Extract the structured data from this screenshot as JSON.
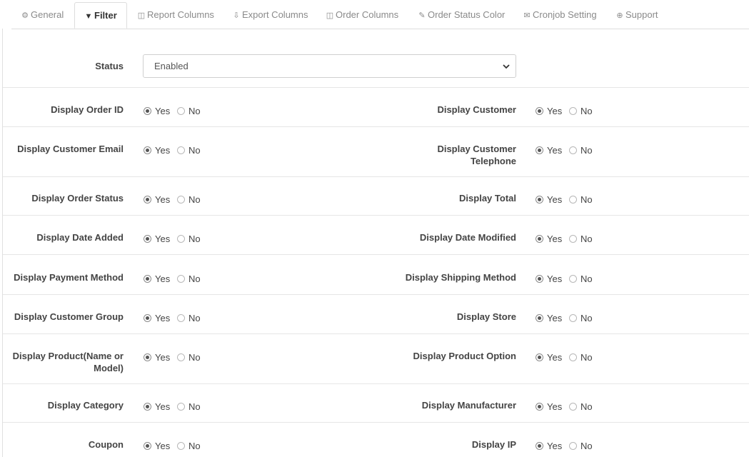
{
  "tabs": [
    {
      "label": "General",
      "icon": "gear-icon"
    },
    {
      "label": "Filter",
      "icon": "filter-icon",
      "active": true
    },
    {
      "label": "Report Columns",
      "icon": "columns-icon"
    },
    {
      "label": "Export Columns",
      "icon": "download-icon"
    },
    {
      "label": "Order Columns",
      "icon": "columns-icon"
    },
    {
      "label": "Order Status Color",
      "icon": "brush-icon"
    },
    {
      "label": "Cronjob Setting",
      "icon": "envelope-icon"
    },
    {
      "label": "Support",
      "icon": "lifebuoy-icon"
    }
  ],
  "status": {
    "label": "Status",
    "value": "Enabled"
  },
  "options": {
    "yes": "Yes",
    "no": "No"
  },
  "rows": [
    {
      "left": {
        "label": "Display Order ID",
        "value": "Yes"
      },
      "right": {
        "label": "Display Customer",
        "value": "Yes"
      }
    },
    {
      "left": {
        "label": "Display Customer Email",
        "value": "Yes"
      },
      "right": {
        "label": "Display Customer Telephone",
        "value": "Yes"
      }
    },
    {
      "left": {
        "label": "Display Order Status",
        "value": "Yes"
      },
      "right": {
        "label": "Display Total",
        "value": "Yes"
      }
    },
    {
      "left": {
        "label": "Display Date Added",
        "value": "Yes"
      },
      "right": {
        "label": "Display Date Modified",
        "value": "Yes"
      }
    },
    {
      "left": {
        "label": "Display Payment Method",
        "value": "Yes"
      },
      "right": {
        "label": "Display Shipping Method",
        "value": "Yes"
      }
    },
    {
      "left": {
        "label": "Display Customer Group",
        "value": "Yes"
      },
      "right": {
        "label": "Display Store",
        "value": "Yes"
      }
    },
    {
      "left": {
        "label": "Display Product(Name or Model)",
        "value": "Yes"
      },
      "right": {
        "label": "Display Product Option",
        "value": "Yes"
      }
    },
    {
      "left": {
        "label": "Display Category",
        "value": "Yes"
      },
      "right": {
        "label": "Display Manufacturer",
        "value": "Yes"
      }
    },
    {
      "left": {
        "label": "Coupon",
        "value": "Yes"
      },
      "right": {
        "label": "Display IP",
        "value": "Yes"
      }
    }
  ]
}
